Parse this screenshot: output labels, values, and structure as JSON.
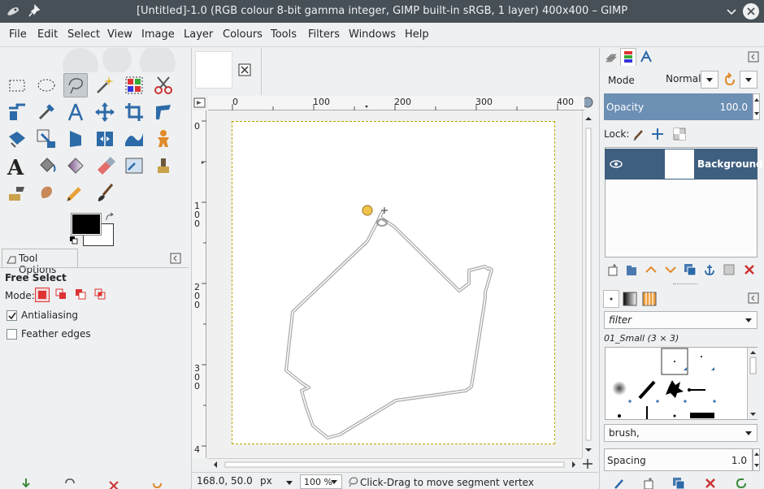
{
  "window": {
    "title": "[Untitled]-1.0 (RGB colour 8-bit gamma integer, GIMP built-in sRGB, 1 layer) 400x400 – GIMP"
  },
  "menu": [
    "File",
    "Edit",
    "Select",
    "View",
    "Image",
    "Layer",
    "Colours",
    "Tools",
    "Filters",
    "Windows",
    "Help"
  ],
  "tool_options": {
    "tab_label": "Tool Options",
    "tool_name": "Free Select",
    "mode_label": "Mode:",
    "antialiasing_label": "Antialiasing",
    "antialiasing_checked": true,
    "feather_label": "Feather edges",
    "feather_checked": false
  },
  "ruler": {
    "h_ticks": [
      "0",
      "100",
      "200",
      "300",
      "400"
    ],
    "v_ticks": [
      "0",
      "1\n0\n0",
      "2\n0\n0",
      "3\n0\n0",
      "4"
    ]
  },
  "status": {
    "coords": "168.0, 50.0",
    "unit": "px",
    "zoom": "100 %",
    "message": "Click-Drag to move segment vertex"
  },
  "layers": {
    "mode_label": "Mode",
    "mode_value": "Normal",
    "opacity_label": "Opacity",
    "opacity_value": "100.0",
    "lock_label": "Lock:",
    "layer_name": "Background"
  },
  "brushes": {
    "filter_placeholder": "filter",
    "current_brush": "01_Small (3 × 3)",
    "tag_value": "brush,",
    "spacing_label": "Spacing",
    "spacing_value": "1.0"
  },
  "colors": {
    "foreground": "#000000",
    "background": "#ffffff",
    "title_bar": "#475057",
    "selection_highlight": "#3f5f80"
  }
}
